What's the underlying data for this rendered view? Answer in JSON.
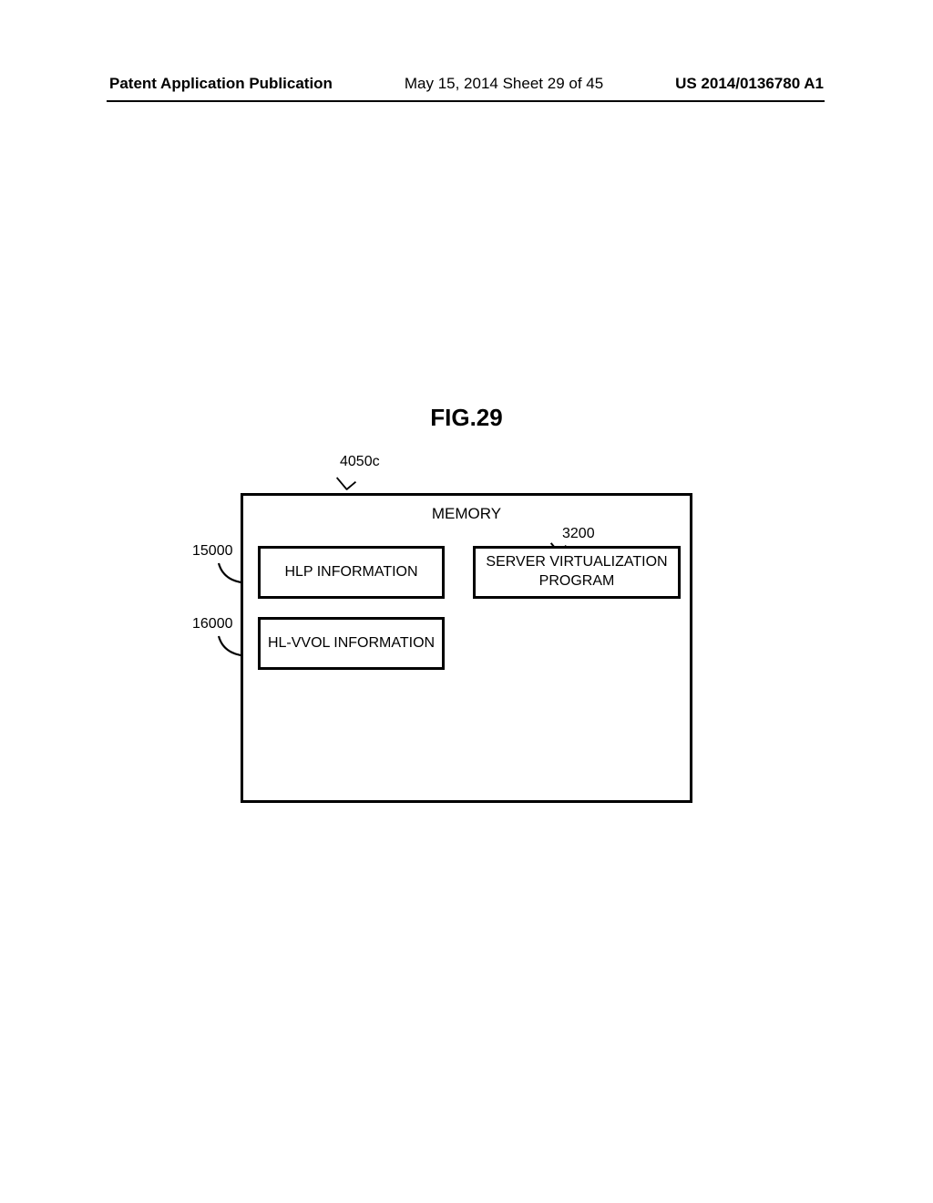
{
  "header": {
    "left": "Patent Application Publication",
    "center": "May 15, 2014  Sheet 29 of 45",
    "right": "US 2014/0136780 A1"
  },
  "figure": {
    "title": "FIG.29",
    "memory_outer_ref": "4050c",
    "memory_label": "MEMORY",
    "hlp_box": "HLP INFORMATION",
    "svp_box": "SERVER VIRTUALIZATION PROGRAM",
    "hlvvol_box": "HL-VVOL INFORMATION",
    "ref_svp": "3200",
    "ref_hlp": "15000",
    "ref_hlvvol": "16000"
  }
}
